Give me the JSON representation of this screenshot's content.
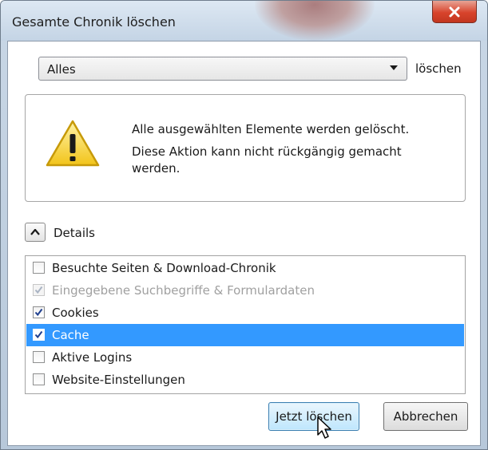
{
  "window": {
    "title": "Gesamte Chronik löschen",
    "close_icon": "close-icon"
  },
  "range": {
    "selected": "Alles",
    "suffix": "löschen",
    "dropdown_icon": "chevron-down-icon"
  },
  "warning": {
    "icon": "warning-icon",
    "line1": "Alle ausgewählten Elemente werden gelöscht.",
    "line2": "Diese Aktion kann nicht rückgängig gemacht werden."
  },
  "details": {
    "label": "Details",
    "toggle_icon": "chevron-up-icon",
    "expanded": true
  },
  "items": [
    {
      "label": "Besuchte Seiten & Download-Chronik",
      "checked": false,
      "enabled": true,
      "selected": false
    },
    {
      "label": "Eingegebene Suchbegriffe & Formulardaten",
      "checked": true,
      "enabled": false,
      "selected": false
    },
    {
      "label": "Cookies",
      "checked": true,
      "enabled": true,
      "selected": false
    },
    {
      "label": "Cache",
      "checked": true,
      "enabled": true,
      "selected": true
    },
    {
      "label": "Aktive Logins",
      "checked": false,
      "enabled": true,
      "selected": false
    },
    {
      "label": "Website-Einstellungen",
      "checked": false,
      "enabled": true,
      "selected": false
    }
  ],
  "buttons": {
    "confirm": "Jetzt löschen",
    "cancel": "Abbrechen"
  },
  "colors": {
    "selection": "#3399ff",
    "close_button": "#d8442c",
    "primary_button": "#bee6fd"
  }
}
